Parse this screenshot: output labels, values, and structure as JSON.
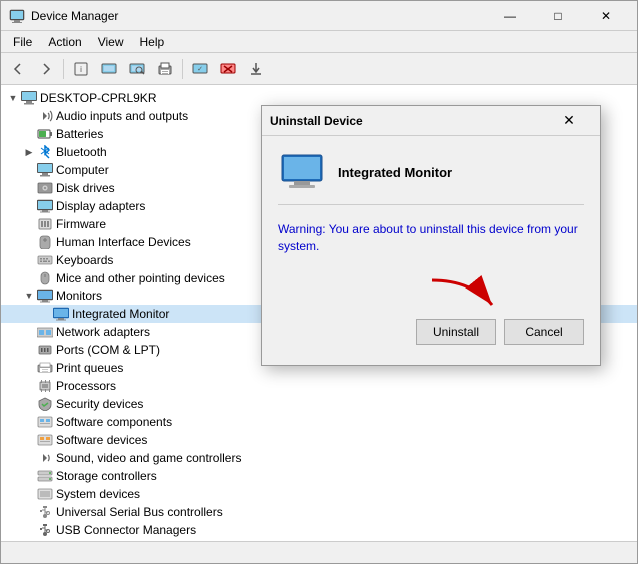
{
  "window": {
    "title": "Device Manager",
    "title_icon": "💻"
  },
  "menu": {
    "items": [
      "File",
      "Action",
      "View",
      "Help"
    ]
  },
  "toolbar": {
    "buttons": [
      "◀",
      "▶",
      "⬛",
      "❓",
      "🖥",
      "⬜",
      "📋",
      "✖",
      "⬇"
    ]
  },
  "tree": {
    "root": "DESKTOP-CPRL9KR",
    "items": [
      {
        "id": "audio",
        "label": "Audio inputs and outputs",
        "icon": "🔊",
        "indent": 1,
        "toggle": " ",
        "expanded": false
      },
      {
        "id": "batteries",
        "label": "Batteries",
        "icon": "🔋",
        "indent": 1,
        "toggle": " ",
        "expanded": false
      },
      {
        "id": "bluetooth",
        "label": "Bluetooth",
        "icon": "📶",
        "indent": 1,
        "toggle": "▶",
        "expanded": false
      },
      {
        "id": "computer",
        "label": "Computer",
        "icon": "💻",
        "indent": 1,
        "toggle": " "
      },
      {
        "id": "disk",
        "label": "Disk drives",
        "icon": "💾",
        "indent": 1,
        "toggle": " "
      },
      {
        "id": "display",
        "label": "Display adapters",
        "icon": "🖥",
        "indent": 1,
        "toggle": " "
      },
      {
        "id": "firmware",
        "label": "Firmware",
        "icon": "⚙",
        "indent": 1,
        "toggle": " "
      },
      {
        "id": "hid",
        "label": "Human Interface Devices",
        "icon": "🖱",
        "indent": 1,
        "toggle": " "
      },
      {
        "id": "keyboards",
        "label": "Keyboards",
        "icon": "⌨",
        "indent": 1,
        "toggle": " "
      },
      {
        "id": "mice",
        "label": "Mice and other pointing devices",
        "icon": "🖱",
        "indent": 1,
        "toggle": " "
      },
      {
        "id": "monitors",
        "label": "Monitors",
        "icon": "🖥",
        "indent": 1,
        "toggle": "▼",
        "expanded": true
      },
      {
        "id": "integrated-monitor",
        "label": "Integrated Monitor",
        "icon": "🖥",
        "indent": 2,
        "toggle": " ",
        "selected": true
      },
      {
        "id": "network",
        "label": "Network adapters",
        "icon": "🌐",
        "indent": 1,
        "toggle": " "
      },
      {
        "id": "ports",
        "label": "Ports (COM & LPT)",
        "icon": "🔌",
        "indent": 1,
        "toggle": " "
      },
      {
        "id": "print",
        "label": "Print queues",
        "icon": "🖨",
        "indent": 1,
        "toggle": " "
      },
      {
        "id": "processors",
        "label": "Processors",
        "icon": "⚙",
        "indent": 1,
        "toggle": " "
      },
      {
        "id": "security",
        "label": "Security devices",
        "icon": "🔒",
        "indent": 1,
        "toggle": " "
      },
      {
        "id": "software-components",
        "label": "Software components",
        "icon": "📦",
        "indent": 1,
        "toggle": " "
      },
      {
        "id": "software-devices",
        "label": "Software devices",
        "icon": "📦",
        "indent": 1,
        "toggle": " "
      },
      {
        "id": "sound",
        "label": "Sound, video and game controllers",
        "icon": "🎵",
        "indent": 1,
        "toggle": " "
      },
      {
        "id": "storage",
        "label": "Storage controllers",
        "icon": "💾",
        "indent": 1,
        "toggle": " "
      },
      {
        "id": "system",
        "label": "System devices",
        "icon": "⚙",
        "indent": 1,
        "toggle": " "
      },
      {
        "id": "usb-serial",
        "label": "Universal Serial Bus controllers",
        "icon": "🔌",
        "indent": 1,
        "toggle": " "
      },
      {
        "id": "usb-connector",
        "label": "USB Connector Managers",
        "icon": "🔌",
        "indent": 1,
        "toggle": " "
      }
    ]
  },
  "dialog": {
    "title": "Uninstall Device",
    "device_name": "Integrated Monitor",
    "warning_text": "Warning: You are about to uninstall this device from your system.",
    "btn_uninstall": "Uninstall",
    "btn_cancel": "Cancel"
  },
  "colors": {
    "accent": "#0078d4",
    "warning_text": "#0000cc",
    "arrow_color": "#cc0000"
  }
}
